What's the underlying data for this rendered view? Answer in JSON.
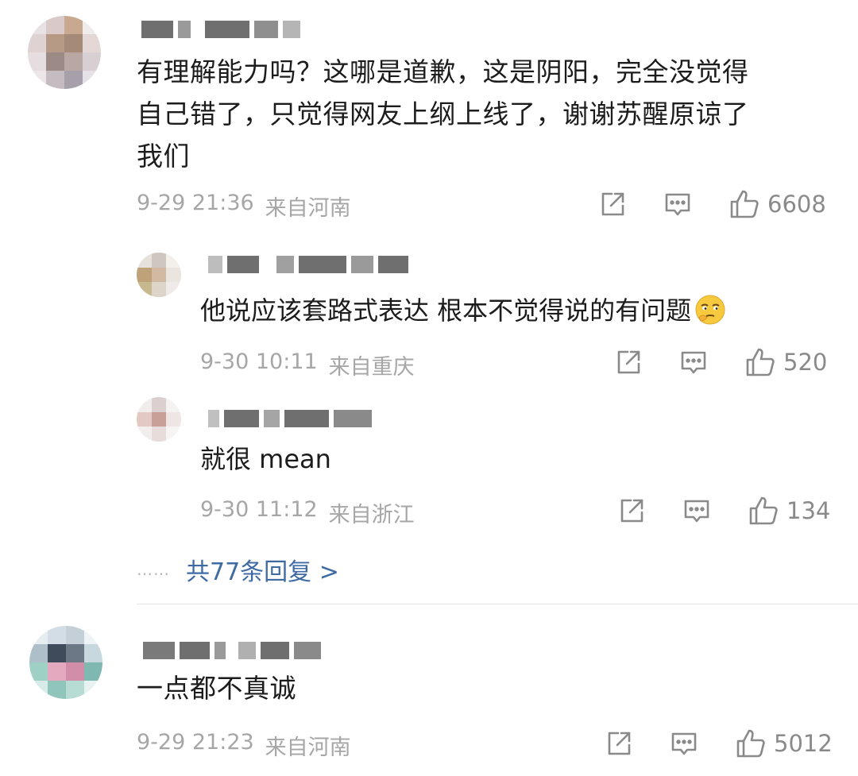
{
  "comments": [
    {
      "text_lines": [
        "有理解能力吗？这哪是道歉，这是阴阳，完全没觉得",
        "自己错了，只觉得网友上纲上线了，谢谢苏醒原谅了",
        "我们"
      ],
      "time": "9-29 21:36",
      "location": "来自河南",
      "likes": "6608",
      "icons": {
        "share": "share-icon",
        "reply": "comment-icon",
        "like": "thumbs-up-icon"
      },
      "replies": [
        {
          "text": "他说应该套路式表达 根本不觉得说的有问题",
          "emoji": "thinking-emoji",
          "time": "9-30 10:11",
          "location": "来自重庆",
          "likes": "520"
        },
        {
          "text": "就很 mean",
          "time": "9-30 11:12",
          "location": "来自浙江",
          "likes": "134"
        }
      ],
      "more_replies": {
        "dots": "……",
        "label": "共77条回复 >"
      }
    },
    {
      "text_lines": [
        "一点都不真诚"
      ],
      "time": "9-29 21:23",
      "location": "来自河南",
      "likes": "5012"
    }
  ],
  "colors": {
    "text": "#1c1c1c",
    "meta": "#a6a6a6",
    "link": "#3f6ba4",
    "icon": "#8a8a8a"
  }
}
